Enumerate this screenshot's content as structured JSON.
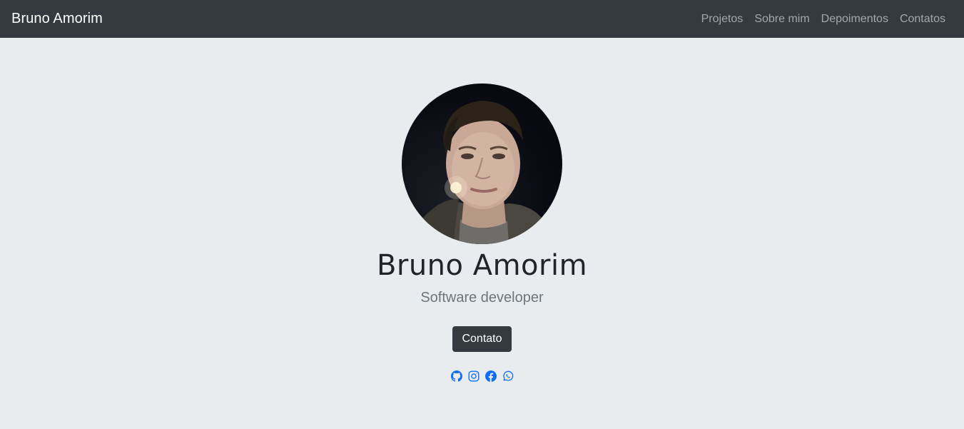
{
  "navbar": {
    "brand": "Bruno Amorim",
    "links": [
      {
        "label": "Projetos"
      },
      {
        "label": "Sobre mim"
      },
      {
        "label": "Depoimentos"
      },
      {
        "label": "Contatos"
      }
    ]
  },
  "hero": {
    "avatar_alt": "Bruno Amorim",
    "name": "Bruno Amorim",
    "subtitle": "Software developer",
    "button_label": "Contato",
    "socials": [
      {
        "icon": "github-icon"
      },
      {
        "icon": "instagram-icon"
      },
      {
        "icon": "facebook-icon"
      },
      {
        "icon": "whatsapp-icon"
      }
    ]
  },
  "colors": {
    "navbar_bg": "#343a40",
    "page_bg": "#e9ecef",
    "link_blue": "#0d6efd",
    "button_bg": "#343a40"
  }
}
